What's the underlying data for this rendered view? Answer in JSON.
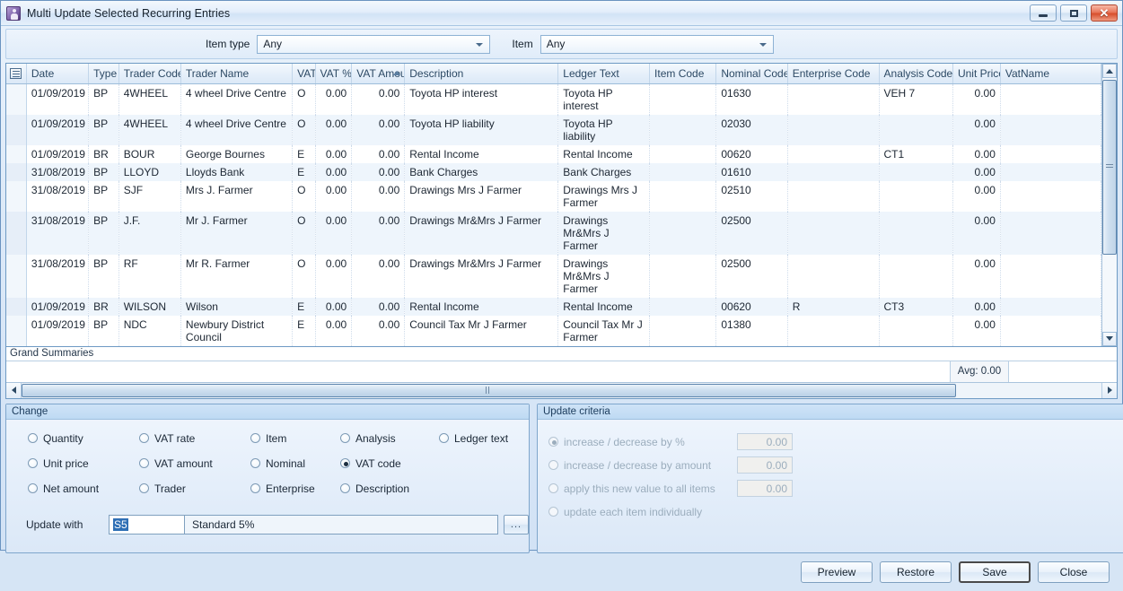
{
  "window": {
    "title": "Multi Update Selected Recurring Entries",
    "icon": "user-shield-icon",
    "minimize_label": "",
    "maximize_label": "",
    "close_label": "✕"
  },
  "filterbar": {
    "item_type_label": "Item type",
    "item_type_value": "Any",
    "item_label": "Item",
    "item_value": "Any"
  },
  "grid": {
    "columns": [
      "Date",
      "Type",
      "Trader Code",
      "Trader Name",
      "VAT",
      "VAT %",
      "VAT Amou",
      "Description",
      "Ledger Text",
      "Item Code",
      "Nominal Code",
      "Enterprise Code",
      "Analysis Code",
      "Unit Price",
      "VatName"
    ],
    "sorted_column": "VAT Amou",
    "rows": [
      {
        "date": "01/09/2019",
        "type": "BP",
        "trader_code": "4WHEEL",
        "trader_name": "4 wheel Drive Centre",
        "vat": "O",
        "vat_pct": "0.00",
        "vat_amount": "0.00",
        "description": "Toyota HP interest",
        "ledger_text": "Toyota HP interest",
        "item_code": "",
        "nominal_code": "01630",
        "enterprise_code": "",
        "analysis_code": "VEH 7",
        "unit_price": "0.00",
        "vat_name": ""
      },
      {
        "date": "01/09/2019",
        "type": "BP",
        "trader_code": "4WHEEL",
        "trader_name": "4 wheel Drive Centre",
        "vat": "O",
        "vat_pct": "0.00",
        "vat_amount": "0.00",
        "description": "Toyota HP liability",
        "ledger_text": "Toyota HP liability",
        "item_code": "",
        "nominal_code": "02030",
        "enterprise_code": "",
        "analysis_code": "",
        "unit_price": "0.00",
        "vat_name": ""
      },
      {
        "date": "01/09/2019",
        "type": "BR",
        "trader_code": "BOUR",
        "trader_name": "George Bournes",
        "vat": "E",
        "vat_pct": "0.00",
        "vat_amount": "0.00",
        "description": "Rental Income",
        "ledger_text": "Rental Income",
        "item_code": "",
        "nominal_code": "00620",
        "enterprise_code": "",
        "analysis_code": "CT1",
        "unit_price": "0.00",
        "vat_name": ""
      },
      {
        "date": "31/08/2019",
        "type": "BP",
        "trader_code": "LLOYD",
        "trader_name": "Lloyds Bank",
        "vat": "E",
        "vat_pct": "0.00",
        "vat_amount": "0.00",
        "description": "Bank Charges",
        "ledger_text": "Bank Charges",
        "item_code": "",
        "nominal_code": "01610",
        "enterprise_code": "",
        "analysis_code": "",
        "unit_price": "0.00",
        "vat_name": ""
      },
      {
        "date": "31/08/2019",
        "type": "BP",
        "trader_code": "SJF",
        "trader_name": "Mrs J. Farmer",
        "vat": "O",
        "vat_pct": "0.00",
        "vat_amount": "0.00",
        "description": "Drawings Mrs J Farmer",
        "ledger_text": "Drawings Mrs J Farmer",
        "item_code": "",
        "nominal_code": "02510",
        "enterprise_code": "",
        "analysis_code": "",
        "unit_price": "0.00",
        "vat_name": ""
      },
      {
        "date": "31/08/2019",
        "type": "BP",
        "trader_code": "J.F.",
        "trader_name": "Mr J. Farmer",
        "vat": "O",
        "vat_pct": "0.00",
        "vat_amount": "0.00",
        "description": "Drawings Mr&Mrs J Farmer",
        "ledger_text": "Drawings Mr&Mrs J Farmer",
        "item_code": "",
        "nominal_code": "02500",
        "enterprise_code": "",
        "analysis_code": "",
        "unit_price": "0.00",
        "vat_name": ""
      },
      {
        "date": "31/08/2019",
        "type": "BP",
        "trader_code": "RF",
        "trader_name": "Mr R. Farmer",
        "vat": "O",
        "vat_pct": "0.00",
        "vat_amount": "0.00",
        "description": "Drawings Mr&Mrs J Farmer",
        "ledger_text": "Drawings Mr&Mrs J Farmer",
        "item_code": "",
        "nominal_code": "02500",
        "enterprise_code": "",
        "analysis_code": "",
        "unit_price": "0.00",
        "vat_name": ""
      },
      {
        "date": "01/09/2019",
        "type": "BR",
        "trader_code": "WILSON",
        "trader_name": "Wilson",
        "vat": "E",
        "vat_pct": "0.00",
        "vat_amount": "0.00",
        "description": "Rental Income",
        "ledger_text": "Rental Income",
        "item_code": "",
        "nominal_code": "00620",
        "enterprise_code": "R",
        "analysis_code": "CT3",
        "unit_price": "0.00",
        "vat_name": ""
      },
      {
        "date": "01/09/2019",
        "type": "BP",
        "trader_code": "NDC",
        "trader_name": "Newbury District Council",
        "vat": "E",
        "vat_pct": "0.00",
        "vat_amount": "0.00",
        "description": "Council Tax Mr J Farmer",
        "ledger_text": "Council Tax Mr J Farmer",
        "item_code": "",
        "nominal_code": "01380",
        "enterprise_code": "",
        "analysis_code": "",
        "unit_price": "0.00",
        "vat_name": ""
      }
    ],
    "summaries_label": "Grand Summaries",
    "summary_value": "Avg: 0.00"
  },
  "change_panel": {
    "title": "Change",
    "options": [
      {
        "label": "Quantity",
        "selected": false
      },
      {
        "label": "VAT rate",
        "selected": false
      },
      {
        "label": "Item",
        "selected": false
      },
      {
        "label": "Analysis",
        "selected": false
      },
      {
        "label": "Ledger text",
        "selected": false
      },
      {
        "label": "Unit price",
        "selected": false
      },
      {
        "label": "VAT amount",
        "selected": false
      },
      {
        "label": "Nominal",
        "selected": false
      },
      {
        "label": "VAT code",
        "selected": true
      },
      {
        "label": "",
        "selected": false
      },
      {
        "label": "Net amount",
        "selected": false
      },
      {
        "label": "Trader",
        "selected": false
      },
      {
        "label": "Enterprise",
        "selected": false
      },
      {
        "label": "Description",
        "selected": false
      },
      {
        "label": "",
        "selected": false
      }
    ],
    "update_with_label": "Update with",
    "update_with_code": "S5",
    "update_with_description": "Standard 5%",
    "browse_button_label": "..."
  },
  "criteria_panel": {
    "title": "Update criteria",
    "disabled": true,
    "options": [
      {
        "label": "increase / decrease by %",
        "selected": true,
        "value": "0.00",
        "has_value": true
      },
      {
        "label": "increase / decrease by amount",
        "selected": false,
        "value": "0.00",
        "has_value": true
      },
      {
        "label": "apply this new value to all items",
        "selected": false,
        "value": "0.00",
        "has_value": true
      },
      {
        "label": "update each item individually",
        "selected": false,
        "value": "",
        "has_value": false
      }
    ]
  },
  "footer": {
    "preview_label": "Preview",
    "restore_label": "Restore",
    "save_label": "Save",
    "close_label": "Close"
  },
  "colors": {
    "accent": "#2f6fb5",
    "frame_border": "#6a93c0",
    "group_title_bg": "#c5def5",
    "close_button": "#d84f2e"
  }
}
